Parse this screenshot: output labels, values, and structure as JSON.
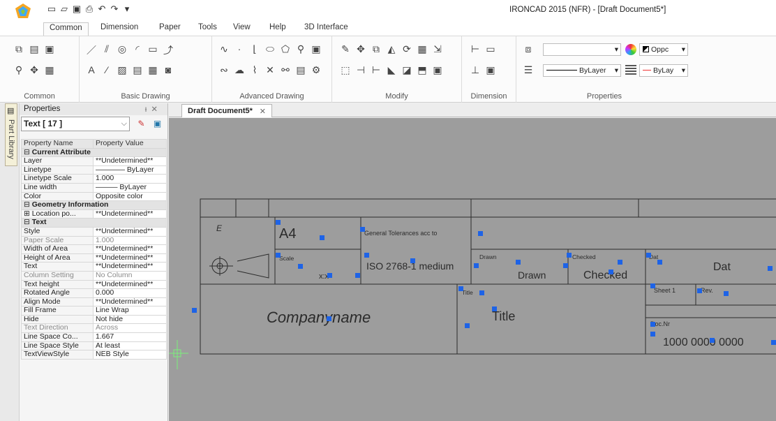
{
  "window": {
    "title": "IRONCAD 2015 (NFR) - [Draft Document5*]"
  },
  "tabs": [
    {
      "label": "Common"
    },
    {
      "label": "Dimension"
    },
    {
      "label": "Paper"
    },
    {
      "label": "Tools"
    },
    {
      "label": "View"
    },
    {
      "label": "Help"
    },
    {
      "label": "3D Interface"
    }
  ],
  "ribbon": {
    "groups": [
      "Common",
      "Basic Drawing",
      "Advanced Drawing",
      "Modify",
      "Dimension",
      "Properties"
    ],
    "properties": {
      "color_dropdown": "Oppc",
      "linetype_dropdown": "ByLayer",
      "lineweight_dropdown": "ByLay"
    }
  },
  "side_tab": {
    "label": "Part Library"
  },
  "properties_panel": {
    "title": "Properties",
    "selector": "Text [ 17 ]",
    "col_name": "Property Name",
    "col_value": "Property Value",
    "rows": [
      {
        "type": "cat",
        "name": "Current Attribute",
        "value": ""
      },
      {
        "type": "row",
        "name": "Layer",
        "value": "**Undetermined**"
      },
      {
        "type": "row",
        "name": "Linetype",
        "value": "———— ByLayer"
      },
      {
        "type": "row",
        "name": "Linetype Scale",
        "value": "1.000"
      },
      {
        "type": "row",
        "name": "Line width",
        "value": "——— ByLayer"
      },
      {
        "type": "row",
        "name": "Color",
        "value": "Opposite color"
      },
      {
        "type": "cat",
        "name": "Geometry Information",
        "value": ""
      },
      {
        "type": "row",
        "name": "⊞ Location po...",
        "value": "**Undetermined**"
      },
      {
        "type": "cat",
        "name": "Text",
        "value": ""
      },
      {
        "type": "row",
        "name": "Style",
        "value": "**Undetermined**"
      },
      {
        "type": "dim",
        "name": "Paper Scale",
        "value": "1.000"
      },
      {
        "type": "row",
        "name": "Width of Area",
        "value": "**Undetermined**"
      },
      {
        "type": "row",
        "name": "Height of Area",
        "value": "**Undetermined**"
      },
      {
        "type": "row",
        "name": "Text",
        "value": "**Undetermined**"
      },
      {
        "type": "dim",
        "name": "Column Setting",
        "value": "No Column"
      },
      {
        "type": "row",
        "name": "Text height",
        "value": "**Undetermined**"
      },
      {
        "type": "row",
        "name": "Rotated Angle",
        "value": "0.000"
      },
      {
        "type": "row",
        "name": "Align Mode",
        "value": "**Undetermined**"
      },
      {
        "type": "row",
        "name": "Fill Frame",
        "value": "Line Wrap"
      },
      {
        "type": "row",
        "name": "Hide",
        "value": "Not hide"
      },
      {
        "type": "dim",
        "name": "Text Direction",
        "value": "Across"
      },
      {
        "type": "row",
        "name": "Line Space Co...",
        "value": "1.667"
      },
      {
        "type": "row",
        "name": "Line Space Style",
        "value": "At least"
      },
      {
        "type": "row",
        "name": "TextViewStyle",
        "value": "NEB Style"
      }
    ]
  },
  "document_tab": {
    "label": "Draft Document5*"
  },
  "drawing": {
    "label_e": "E",
    "format": "A4",
    "general_tolerances": "General Tolerances acc to",
    "scale_label": "Scale",
    "scale_value": "x:x",
    "tolerance_value": "ISO 2768-1 medium",
    "drawn_label": "Drawn",
    "drawn_value": "Drawn",
    "checked_label": "Checked",
    "checked_value": "Checked",
    "dat_label": "Dat",
    "dat_value": "Dat",
    "sheet_label": "Sheet 1",
    "rev_label": "Rev.",
    "company": "Companyname",
    "title_label": "Title",
    "title_value": "Title",
    "docnr_label": "Doc.Nr",
    "docnr_value": "1000 0000 0000"
  }
}
